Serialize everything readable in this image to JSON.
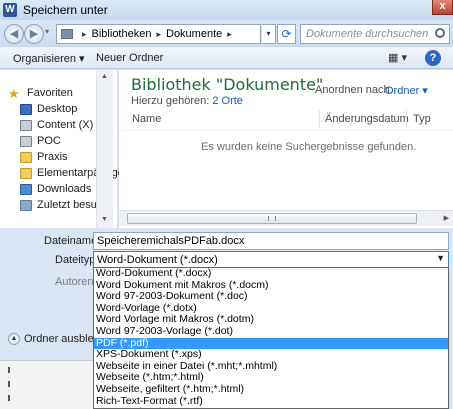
{
  "window": {
    "title": "Speichern unter",
    "app_icon_letter": "W",
    "close_glyph": "x"
  },
  "address": {
    "crumbs": [
      "Bibliotheken",
      "Dokumente"
    ],
    "search_placeholder": "Dokumente durchsuchen"
  },
  "toolbar": {
    "organize_label": "Organisieren ▾",
    "new_folder_label": "Neuer Ordner",
    "help_label": "?"
  },
  "sidebar": {
    "items": [
      {
        "label": "Favoriten",
        "icon": "star-icon"
      },
      {
        "label": "Desktop",
        "icon": "desktop-icon"
      },
      {
        "label": "Content (X)",
        "icon": "drive-icon"
      },
      {
        "label": "POC",
        "icon": "drive-icon"
      },
      {
        "label": "Praxis",
        "icon": "folder-icon"
      },
      {
        "label": "Elementarpädago",
        "icon": "folder-icon"
      },
      {
        "label": "Downloads",
        "icon": "downloads-icon"
      },
      {
        "label": "Zuletzt besucht",
        "icon": "recent-icon"
      }
    ]
  },
  "main": {
    "library_title": "Bibliothek \"Dokumente\"",
    "library_sub_prefix": "Hierzu gehören:",
    "library_sub_link": "2 Orte",
    "arrange_label": "Anordnen nach:",
    "arrange_value": "Ordner ▾",
    "columns": [
      "Name",
      "Änderungsdatum",
      "Typ"
    ],
    "empty_message": "Es wurden keine Suchergebnisse gefunden."
  },
  "form": {
    "filename_label": "Dateiname:",
    "filename_value": "SpeicheremichalsPDFab.docx",
    "filetype_label": "Dateityp:",
    "filetype_value": "Word-Dokument (*.docx)",
    "authors_label": "Autoren:",
    "hide_folders_label": "Ordner ausblende"
  },
  "filetype_options": [
    "Word-Dokument (*.docx)",
    "Word Dokument mit Makros (*.docm)",
    "Word 97-2003-Dokument (*.doc)",
    "Word-Vorlage (*.dotx)",
    "Word Vorlage mit Makros (*.dotm)",
    "Word 97-2003-Vorlage (*.dot)",
    "PDF (*.pdf)",
    "XPS-Dokument (*.xps)",
    "Webseite in einer Datei (*.mht;*.mhtml)",
    "Webseite (*.htm;*.html)",
    "Webseite, gefiltert (*.htm;*.html)",
    "Rich-Text-Format (*.rtf)",
    "Nur Text (*.txt)"
  ],
  "selected_option_index": 6,
  "colors": {
    "library_title": "#1e6e42",
    "link": "#1a5bb0",
    "selection": "#3399ff"
  }
}
